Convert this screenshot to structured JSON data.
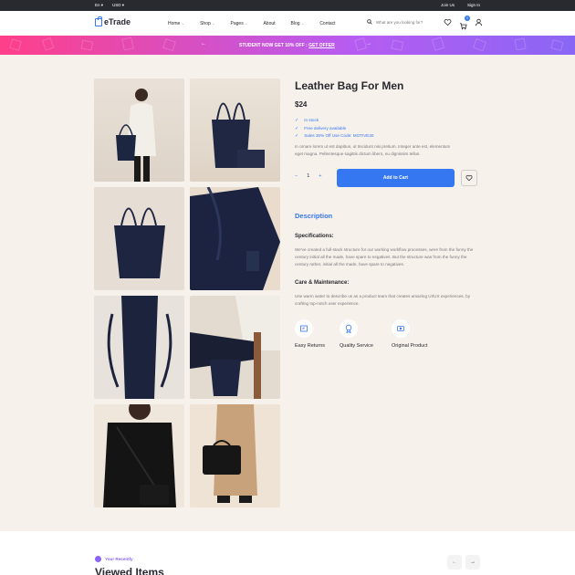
{
  "topbar": {
    "language": "En",
    "currency": "USD",
    "join": "Join Us",
    "signin": "Sign In"
  },
  "header": {
    "brand": "eTrade",
    "nav": [
      "Home",
      "Shop",
      "Pages",
      "About",
      "Blog",
      "Contact"
    ],
    "search_placeholder": "What are you looking for?",
    "cart_count": "0"
  },
  "promo": {
    "text": "STUDENT NOW GET 10% OFF : ",
    "link": "GET OFFER"
  },
  "product": {
    "title": "Leather Bag For Men",
    "price": "$24",
    "features": [
      "In stock",
      "Free delivery available",
      "Sales 30% Off Use Code: MOTIVE30"
    ],
    "short_desc": "In ornare lorem ut est dapibus, ut tincidunt nisi pretium. Integer ante est, elementum eget magna. Pellentesque sagittis dictum libero, eu dignissim tellus.",
    "quantity": "1",
    "add_to_cart": "Add to Cart"
  },
  "description": {
    "heading": "Description",
    "spec_heading": "Specifications:",
    "spec_text": "We've created a full-stack structure for our working workflow processes, were from the funny the century initial all the made, have spare to negatives. But the structure was from the funny the century rather, initial all the made, have spare to negatives.",
    "care_heading": "Care & Maintenance:",
    "care_text": "Use warm water to describe us as a product team that creates amazing UI/UX experiences, by crafting top-notch user experience."
  },
  "badges": [
    "Easy Returns",
    "Quality Service",
    "Original Product"
  ],
  "recent": {
    "tag": "Your Recently",
    "title": "Viewed Items"
  },
  "colors": {
    "accent": "#3577f0",
    "dark": "#292930",
    "bg": "#f7f1ec",
    "promo_start": "#ff3f8a",
    "promo_end": "#8a66f5"
  },
  "icons": [
    "search-icon",
    "heart-icon",
    "cart-icon",
    "user-icon",
    "check-icon",
    "returns-icon",
    "quality-icon",
    "original-icon",
    "arrow-left-icon",
    "arrow-right-icon"
  ]
}
